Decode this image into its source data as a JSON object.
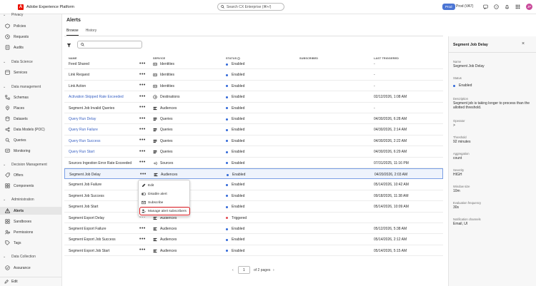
{
  "app": {
    "title": "Adobe Experience Platform",
    "logo_letter": "A"
  },
  "search": {
    "placeholder": "Search CX Enterprise (⌘+/)"
  },
  "header": {
    "env_badge": "Prod",
    "sandbox": "Prod (VA7)",
    "avatar_initials": "JP"
  },
  "sidebar": {
    "sections": [
      {
        "label": "Privacy",
        "items": [
          "Policies",
          "Requests",
          "Audits"
        ]
      },
      {
        "label": "Data Science",
        "items": [
          "Services"
        ]
      },
      {
        "label": "Data management",
        "items": [
          "Schemas",
          "Places",
          "Datasets",
          "Data Models (POC)",
          "Queries",
          "Monitoring"
        ]
      },
      {
        "label": "Decision Management",
        "items": [
          "Offers",
          "Components"
        ]
      },
      {
        "label": "Administration",
        "items": [
          "Alerts",
          "Sandboxes",
          "Permissions",
          "Tags"
        ]
      },
      {
        "label": "Data Collection",
        "items": [
          "Assurance"
        ]
      }
    ],
    "active_item": "Alerts",
    "bottom": "Edit"
  },
  "page": {
    "title": "Alerts",
    "tabs": [
      "Browse",
      "History"
    ],
    "active_tab": "Browse",
    "search_placeholder": ""
  },
  "table": {
    "columns": [
      "NAME",
      "SERVICE",
      "STATUS",
      "SUBSCRIBED",
      "LAST TRIGGERED"
    ],
    "rows": [
      {
        "name": "Feed Shared",
        "link": false,
        "service": "Identities",
        "status": "Enabled",
        "triggered": "-"
      },
      {
        "name": "Link Request",
        "link": false,
        "service": "Identities",
        "status": "Enabled",
        "triggered": "-"
      },
      {
        "name": "Link Action",
        "link": false,
        "service": "Identities",
        "status": "Enabled",
        "triggered": "-"
      },
      {
        "name": "Activation Skipped Rate Exceeded",
        "link": true,
        "service": "Destinations",
        "status": "Enabled",
        "triggered": "02/12/2026, 1:08 AM"
      },
      {
        "name": "Segment Job Invalid Queries",
        "link": false,
        "service": "Audiences",
        "status": "Enabled",
        "triggered": "-"
      },
      {
        "name": "Query Run Delay",
        "link": true,
        "service": "Queries",
        "status": "Enabled",
        "triggered": "04/30/2026, 6:28 AM"
      },
      {
        "name": "Query Run Failure",
        "link": true,
        "service": "Queries",
        "status": "Enabled",
        "triggered": "04/30/2026, 2:14 AM"
      },
      {
        "name": "Query Run Success",
        "link": true,
        "service": "Queries",
        "status": "Enabled",
        "triggered": "04/30/2026, 2:22 AM"
      },
      {
        "name": "Query Run Start",
        "link": true,
        "service": "Queries",
        "status": "Enabled",
        "triggered": "04/30/2026, 6:29 AM"
      },
      {
        "name": "Sources Ingestion Error Rate Exceeded",
        "link": false,
        "service": "Sources",
        "status": "Enabled",
        "triggered": "07/31/2025, 11:16 PM"
      },
      {
        "name": "Segment Job Delay",
        "link": false,
        "service": "Audiences",
        "status": "Enabled",
        "triggered": "04/20/2026, 2:03 AM",
        "selected": true
      },
      {
        "name": "Segment Job Failure",
        "link": false,
        "service": "",
        "status": "Enabled",
        "triggered": "05/14/2026, 10:42 AM"
      },
      {
        "name": "Segment Job Success",
        "link": false,
        "service": "",
        "status": "Enabled",
        "triggered": "09/18/2026, 11:38 AM"
      },
      {
        "name": "Segment Job Start",
        "link": false,
        "service": "",
        "status": "Enabled",
        "triggered": "05/14/2026, 10:09 AM"
      },
      {
        "name": "Segment Export Delay",
        "link": false,
        "service": "Audiences",
        "status": "Triggered",
        "triggered": ""
      },
      {
        "name": "Segment Export Failure",
        "link": false,
        "service": "Audiences",
        "status": "Enabled",
        "triggered": "05/12/2026, 5:38 AM"
      },
      {
        "name": "Segment Export Job Success",
        "link": false,
        "service": "Audiences",
        "status": "Enabled",
        "triggered": "05/14/2026, 2:12 AM"
      },
      {
        "name": "Segment Export Job Start",
        "link": false,
        "service": "Audiences",
        "status": "Enabled",
        "triggered": "05/14/2026, 5:15 AM"
      }
    ]
  },
  "context_menu": {
    "items": [
      "Edit",
      "Disable alert",
      "Subscribe",
      "Manage alert subscribers"
    ]
  },
  "pagination": {
    "page": "1",
    "total": "of 2 pages",
    "prev": "‹",
    "next": "›"
  },
  "panel": {
    "title": "Segment Job Delay",
    "fields": [
      {
        "label": "Name",
        "value": "Segment Job Delay"
      },
      {
        "label": "Status",
        "value": "Enabled"
      },
      {
        "label": "Description",
        "value": "Segment job is taking longer to process than the allotted threshold."
      },
      {
        "label": "Operator",
        "value": ">"
      },
      {
        "label": "Threshold",
        "value": "92 minutes"
      },
      {
        "label": "Aggregation",
        "value": "count"
      },
      {
        "label": "Severity",
        "value": "HIGH"
      },
      {
        "label": "Window size",
        "value": "10m"
      },
      {
        "label": "Evaluation frequency",
        "value": "30s"
      },
      {
        "label": "Notification channels",
        "value": "Email, UI"
      }
    ]
  },
  "colors": {
    "accent": "#3168d8",
    "brand": "#eb1000",
    "highlight": "#d7141a",
    "triggered": "#e34850"
  }
}
